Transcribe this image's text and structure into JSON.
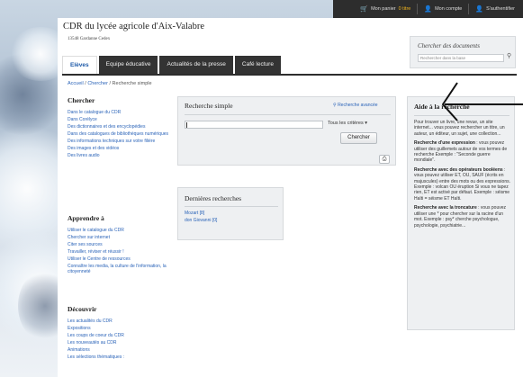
{
  "topbar": {
    "basket_label": "Mon panier",
    "basket_count": "0 titre",
    "account_label": "Mon compte",
    "auth_label": "S'authentifier"
  },
  "site": {
    "title": "CDR du lycée agricole d'Aix-Valabre",
    "subtitle": "13548 Gardanne Cedex"
  },
  "search_box": {
    "label": "Chercher des documents",
    "placeholder": "Rechercher dans la base"
  },
  "nav": {
    "tabs": [
      {
        "label": "Elèves"
      },
      {
        "label": "Equipe éducative"
      },
      {
        "label": "Actualités de la presse"
      },
      {
        "label": "Café lecture"
      }
    ]
  },
  "breadcrumb": {
    "home": "Accueil",
    "sep1": " / ",
    "chercher": "Chercher",
    "sep2": " / ",
    "current": "Recherche simple"
  },
  "left": {
    "chercher": {
      "title": "Chercher",
      "items": [
        "Dans le catalogue du CDR",
        "Dans Corélyce",
        "Des dictionnaires et des encyclopédies",
        "Dans des catalogues de bibliothèques numériques",
        "Des informations techniques sur votre filière",
        "Des images et des vidéos",
        "Des livres audio"
      ]
    },
    "apprendre": {
      "title": "Apprendre à",
      "items": [
        "Utiliser le catalogue du CDR",
        "Chercher sur internet",
        "Citer ses sources",
        "Travailler, réviser et réussir !",
        "Utiliser le Centre de ressources",
        "Connaître les media, la culture de l'information, la citoyenneté"
      ]
    },
    "decouvrir": {
      "title": "Découvrir",
      "items": [
        "Les actualités du CDR",
        "Expositions",
        "Les coups de coeur du CDR",
        "Les nouveautés au CDR",
        "Animations",
        "Les sélections thématiques :"
      ]
    }
  },
  "simple_search": {
    "title": "Recherche simple",
    "advanced_link": "Recherche avancée",
    "criteria": "Tous les critères",
    "button": "Chercher"
  },
  "recent": {
    "title": "Dernières recherches",
    "items": [
      "Mozart [8]",
      "don Giovanni [0]"
    ]
  },
  "help": {
    "title": "Aide à la recherche",
    "intro": "Pour trouver un livre, une revue, un site internet... vous pouvez rechercher un titre, un auteur, un éditeur, un sujet, une collection...",
    "expr_title": "Recherche d'une expression",
    "expr_text": ": vous pouvez utiliser des guillemets autour de vos termes de recherche Exemple : \"Seconde guerre mondiale\".",
    "bool_title": "Recherche avec des opérateurs booléens",
    "bool_text": ": vous pouvez utiliser ET, OU, SAUF (écrits en majuscules) entre des mots ou des expressions. Exemple : volcan OU éruption Si vous ne tapez rien, ET est activé par défaut. Exemple : séisme Haïti = séisme ET Haïti.",
    "trunc_title": "Recherche avec la troncature",
    "trunc_text": ": vous pouvez utiliser une * pour chercher sur la racine d'un mot. Exemple : psy* cherche psychologue, psychologie, psychiatrie..."
  }
}
